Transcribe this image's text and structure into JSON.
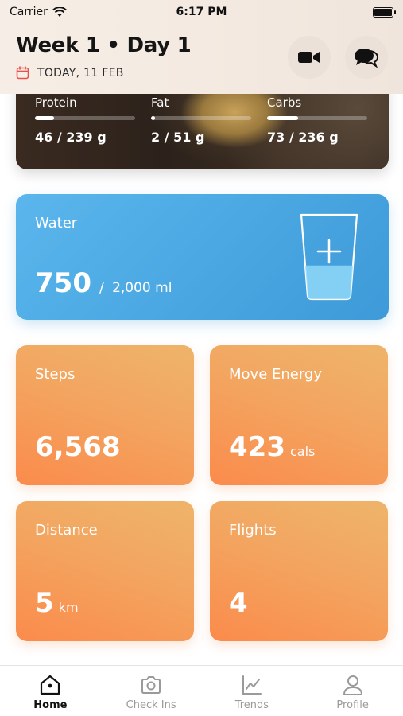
{
  "status_bar": {
    "carrier": "Carrier",
    "time": "6:17 PM"
  },
  "header": {
    "title": "Week 1 • Day 1",
    "date": "TODAY, 11 FEB",
    "accent_color": "#e8524a"
  },
  "macros": [
    {
      "label": "Protein",
      "value": "46 / 239 g",
      "progress": 0.19
    },
    {
      "label": "Fat",
      "value": "2 / 51 g",
      "progress": 0.04
    },
    {
      "label": "Carbs",
      "value": "73 / 236 g",
      "progress": 0.31
    }
  ],
  "water": {
    "title": "Water",
    "value": "750",
    "slash": "/",
    "goal": "2,000 ml",
    "progress": 0.375,
    "color": "#4aa8e2"
  },
  "stats": [
    {
      "title": "Steps",
      "value": "6,568",
      "unit": ""
    },
    {
      "title": "Move Energy",
      "value": "423",
      "unit": "cals"
    },
    {
      "title": "Distance",
      "value": "5",
      "unit": "km"
    },
    {
      "title": "Flights",
      "value": "4",
      "unit": ""
    }
  ],
  "stat_color": "#f59a58",
  "tabs": [
    {
      "label": "Home",
      "icon": "home-icon",
      "active": true
    },
    {
      "label": "Check Ins",
      "icon": "camera-icon",
      "active": false
    },
    {
      "label": "Trends",
      "icon": "trends-icon",
      "active": false
    },
    {
      "label": "Profile",
      "icon": "profile-icon",
      "active": false
    }
  ]
}
